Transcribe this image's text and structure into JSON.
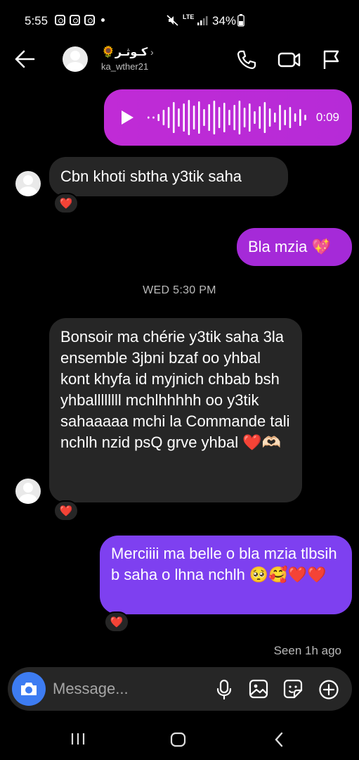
{
  "status": {
    "time": "5:55",
    "battery": "34%",
    "network": "LTE"
  },
  "header": {
    "name": "🌻كـوثـر",
    "username": "ka_wther21"
  },
  "voice_message": {
    "duration": "0:09"
  },
  "messages": {
    "m1": "Cbn khoti sbtha y3tik saha",
    "m1_reaction": "❤️",
    "m2": "Bla mzia 💖",
    "m3": "Bonsoir ma chérie y3tik saha 3la ensemble 3jbni bzaf oo yhbal kont khyfa id myjnich chbab bsh yhballllllll mchlhhhhh oo y3tik sahaaaaa mchi la Commande tali nchlh nzid psQ grve yhbal ❤️🫶🏻",
    "m3_reaction": "❤️",
    "m4": "Merciiii ma belle o bla mzia tlbsih b saha o lhna nchlh 🥺🥰❤️❤️",
    "m4_reaction": "❤️"
  },
  "timestamp": "WED 5:30 PM",
  "seen": "Seen 1h ago",
  "composer": {
    "placeholder": "Message..."
  },
  "colors": {
    "outgoing": "#a52ad8",
    "incoming": "#262626",
    "camera": "#3d7cf2"
  },
  "icons": [
    "back-arrow-icon",
    "phone-icon",
    "video-icon",
    "flag-icon",
    "play-icon",
    "camera-icon",
    "mic-icon",
    "gallery-icon",
    "sticker-icon",
    "plus-icon"
  ]
}
